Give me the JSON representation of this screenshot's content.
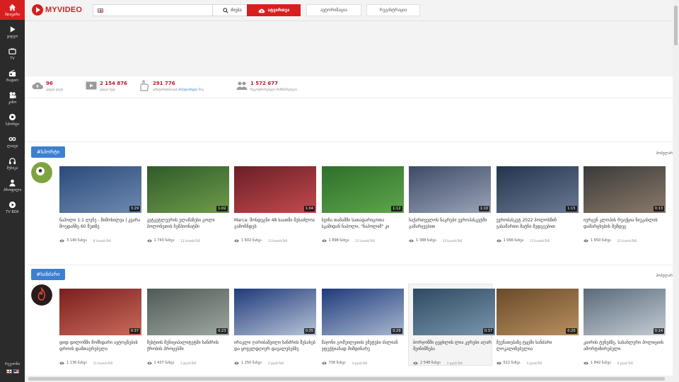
{
  "sidebar": {
    "items": [
      {
        "label": "მთავარი",
        "icon": "home-icon"
      },
      {
        "label": "ვიდეო",
        "icon": "play-icon"
      },
      {
        "label": "TV",
        "icon": "tv-icon"
      },
      {
        "label": "რადიო",
        "icon": "radio-icon"
      },
      {
        "label": "კინო",
        "icon": "film-icon"
      },
      {
        "label": "სპორტი",
        "icon": "soccer-ball-icon"
      },
      {
        "label": "ლაივი",
        "icon": "infinity-icon"
      },
      {
        "label": "მუსიკა",
        "icon": "headphones-icon"
      },
      {
        "label": "პროფილი",
        "icon": "user-icon"
      },
      {
        "label": "TV BOX",
        "icon": "tv-box-icon"
      }
    ],
    "language_label": "რეგიონი"
  },
  "header": {
    "logo_text": "MYVIDEO",
    "search_placeholder": "",
    "search_button": "ძიება",
    "upload_button": "ატვირთვა",
    "auth_button": "ავტორიზაცია",
    "register_button": "რეგისტრაცია"
  },
  "stats": [
    {
      "value": "96",
      "label": "ვიდეო დღეს",
      "icon": "cloud-upload-icon"
    },
    {
      "value": "2 154 876",
      "label": "ვიდეო სულ",
      "icon": "video-icon"
    },
    {
      "value": "291 776",
      "label_pre": "ვიზიტორებისთვის",
      "label_hl": "პოპულარული",
      "label_post": "შოუ",
      "icon": "hand-icon"
    },
    {
      "value": "1 572 677",
      "label": "რეგისტრირებული მომხმარებელი",
      "icon": "users-icon"
    }
  ],
  "sections": [
    {
      "tag": "#სპორტი",
      "more": "პოპულარ",
      "cards": [
        {
          "title": "ნაპოლი 1:1 ლეჩე - მიმოხილვა | კვარა მოედანზე 60 წუთზე",
          "duration": "3:29",
          "views": "3 140 ნახვა",
          "ago": "8 საათის წინ",
          "colors": [
            "#2b4a7a",
            "#6e8ab0"
          ]
        },
        {
          "title": "კეტკეტლუერის ულამაზესი გოლი პოლონეთის ჩემპიონატში",
          "duration": "1:02",
          "views": "1 743 ნახვა",
          "ago": "13 საათის წინ",
          "colors": [
            "#2f5a2a",
            "#6f9c4a"
          ]
        },
        {
          "title": "Marca: მოსდეგნი 48 საათში შესაძლოა გამოჩნდეს",
          "duration": "1:04",
          "views": "1 602 ნახვა",
          "ago": "13 საათის წინ",
          "colors": [
            "#6a1f25",
            "#c34a4f"
          ]
        },
        {
          "title": "ხვიჩა თამამში სათადარიგოთა სკამიდან ნაპოლი, \"ნაპოლიმ\" კი",
          "duration": "1:12",
          "views": "1 898 ნახვა",
          "ago": "13 საათის წინ",
          "colors": [
            "#2e6e2c",
            "#5ea64a"
          ]
        },
        {
          "title": "საქართველოს ნაკრები ევროპასკეტში გამარჯვებით",
          "duration": "1:10",
          "views": "1 388 ნახვა",
          "ago": "13 საათის წინ",
          "colors": [
            "#3e4a66",
            "#9aa4b8"
          ]
        },
        {
          "title": "ევრობასკეტ 2022 ბოლოსწინ გასამართი მატჩი შედეგებით",
          "duration": "1:15",
          "views": "1 066 ნახვა",
          "ago": "13 საათის წინ",
          "colors": [
            "#24344e",
            "#6b7a92"
          ]
        },
        {
          "title": "იურგენ კლოპის რეაქცია ნიუკასლის დამარცხების შემდეგ",
          "duration": "0:13",
          "views": "1 650 ნახვა",
          "ago": "21 საათის წინ",
          "colors": [
            "#3a3a3a",
            "#8a7a6a"
          ]
        }
      ]
    },
    {
      "tag": "#ხანძარი",
      "more": "პოპულარ",
      "cards": [
        {
          "title": "დიდ დილომში მომხდარი ავტოგზების დროის დამთავრებულა",
          "duration": "0:37",
          "views": "1 136 ნახვა",
          "ago": "11 საათის წინ",
          "colors": [
            "#7a1f1f",
            "#c96a5a"
          ]
        },
        {
          "title": "მესტიის მუნიციპალიტეტში ხანძრის ქრობის პროცესში",
          "duration": "0:23",
          "views": "1 437 ნახვა",
          "ago": "2 დღის წინ",
          "colors": [
            "#4f5a56",
            "#9ea8a2"
          ]
        },
        {
          "title": "ირაკლი ღარიბაშვილი ხანძრის შესახებ და ყოველდღიურ დავალებებზე",
          "duration": "0:35",
          "views": "1 250 ნახვა",
          "ago": "3 დღის წინ",
          "colors": [
            "#1f3a7a",
            "#b8c4d8"
          ]
        },
        {
          "title": "მაჯონი გომუილეთის უმეტესი ძალიან ეფექტიანად მიმდინარე",
          "duration": "0:29",
          "views": "738 ნახვა",
          "ago": "3 დღის წინ",
          "colors": [
            "#1f3a7a",
            "#a8b8d0"
          ]
        },
        {
          "title": "ბორჯომში ცეცხლის ლია კერები აღარ შეინიშნება",
          "duration": "0:37",
          "views": "2 548 ნახვა",
          "ago": "3 დღის წინ",
          "colors": [
            "#2e4a62",
            "#7a96ac"
          ]
        },
        {
          "title": "შეუნათებაზე ტყემი ხანძარი ლოკალიზებულია",
          "duration": "0:20",
          "views": "522 ნახვა",
          "ago": "4 დღის წინ",
          "colors": [
            "#6a4a2a",
            "#b89060"
          ]
        },
        {
          "title": "კაირის ტუნებზე, სასახლერი პოლიციის ამორტიზირებული",
          "duration": "0:14",
          "views": "1 842 ნახვა",
          "ago": "6 დღის წინ",
          "colors": [
            "#5a6a7a",
            "#c4ccd4"
          ]
        }
      ]
    }
  ],
  "colors": {
    "accent": "#d71f1f",
    "tag": "#3d7fd0",
    "stat": "#c8102e",
    "sidebar": "#2b2b2b"
  }
}
